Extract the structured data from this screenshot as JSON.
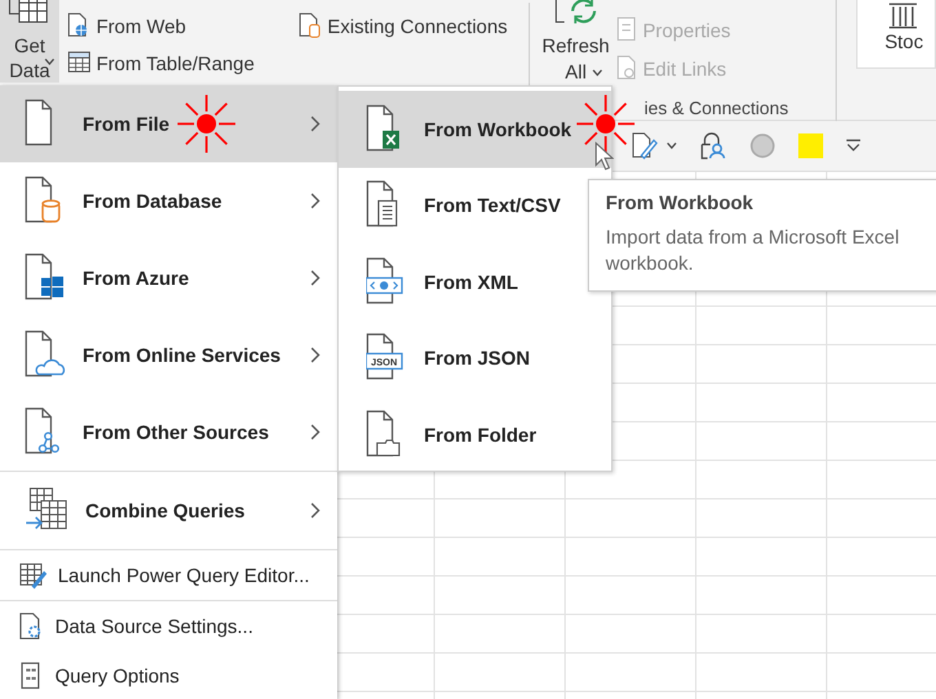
{
  "ribbon": {
    "get_data": {
      "line1": "Get",
      "line2": "Data"
    },
    "commands": [
      {
        "label": "From Web",
        "disabled": false
      },
      {
        "label": "From Table/Range",
        "disabled": false
      },
      {
        "label": "Existing Connections",
        "disabled": false
      }
    ],
    "refresh_all": {
      "line1": "Refresh",
      "line2": "All"
    },
    "query_commands": [
      {
        "label": "Properties",
        "disabled": true
      },
      {
        "label": "Edit Links",
        "disabled": true
      }
    ],
    "group_label": "ies & Connections",
    "stock": "Stoc"
  },
  "get_data_menu": {
    "sections": [
      [
        {
          "label": "From File",
          "kind": "submenu",
          "selected": true
        },
        {
          "label": "From Database",
          "kind": "submenu",
          "selected": false
        },
        {
          "label": "From Azure",
          "kind": "submenu",
          "selected": false
        },
        {
          "label": "From Online Services",
          "kind": "submenu",
          "selected": false
        },
        {
          "label": "From Other Sources",
          "kind": "submenu",
          "selected": false
        }
      ],
      [
        {
          "label": "Combine Queries",
          "kind": "submenu",
          "selected": false
        }
      ],
      [
        {
          "label": "Launch Power Query Editor...",
          "kind": "command",
          "selected": false
        }
      ],
      [
        {
          "label": "Data Source Settings...",
          "kind": "command",
          "selected": false
        },
        {
          "label": "Query Options",
          "kind": "command",
          "selected": false
        }
      ]
    ]
  },
  "file_submenu": {
    "items": [
      {
        "label": "From Workbook",
        "selected": true
      },
      {
        "label": "From Text/CSV",
        "selected": false
      },
      {
        "label": "From XML",
        "selected": false
      },
      {
        "label": "From JSON",
        "selected": false,
        "icon_text": "JSON"
      },
      {
        "label": "From Folder",
        "selected": false
      }
    ]
  },
  "tooltip": {
    "title": "From Workbook",
    "description": "Import data from a Microsoft Excel workbook."
  }
}
